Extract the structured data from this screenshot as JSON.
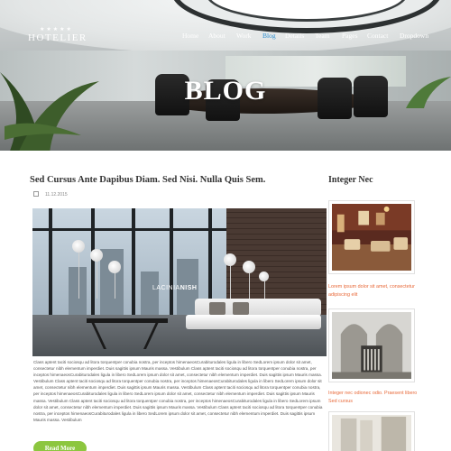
{
  "header": {
    "logo_stars": "★★★★★",
    "logo_text": "HOTELIER",
    "nav": [
      {
        "label": "Home",
        "active": false
      },
      {
        "label": "About",
        "active": false
      },
      {
        "label": "Work",
        "active": false
      },
      {
        "label": "Blog",
        "active": true
      },
      {
        "label": "Details",
        "active": false
      },
      {
        "label": "Team",
        "active": false
      },
      {
        "label": "Pages",
        "active": false
      },
      {
        "label": "Contact",
        "active": false
      },
      {
        "label": "Dropdown",
        "active": false
      }
    ],
    "hero_title": "BLOG"
  },
  "post": {
    "title": "Sed Cursus Ante Dapibus Diam. Sed Nisi. Nulla Quis Sem.",
    "date": "11.12.2015",
    "image_caption_light": "LACINIA",
    "image_caption_bold": "NISH",
    "body": "Class aptent taciti sociosqu ad litora torquentper conubia nostra, per inceptos himenaeosCurabiturodales ligula in libero SedLorem ipsum dolor sit amet, consectetur nibh elementum imperdiet. Duis sagittis ipsum Mauris massa. Vestibulum Class aptent taciti sociosqu ad litora torquentper conubia nostra, per inceptos himenaeosCurabiturodales ligula in libero SedLorem ipsum dolor sit amet, consectetur nibh elementum imperdiet. Duis sagittis ipsum Mauris massa. Vestibulum Class aptent taciti sociosqu ad litora torquentper conubia nostra, per inceptos himenaeosCurabiturodales ligula in libero SedLorem ipsum dolor sit amet, consectetur nibh elementum imperdiet. Duis sagittis ipsum Mauris massa. Vestibulum Class aptent taciti sociosqu ad litora torquentper conubia nostra, per inceptos himenaeosCurabiturodales ligula in libero SedLorem ipsum dolor sit amet, consectetur nibh elementum imperdiet. Duis sagittis ipsum Mauris massa. Vestibulum Class aptent taciti sociosqu ad litora torquentper conubia nostra, per inceptos himenaeosCurabiturodales ligula in libero SedLorem ipsum dolor sit amet, consectetur nibh elementum imperdiet. Duis sagittis ipsum Mauris massa. Vestibulum Class aptent taciti sociosqu ad litora torquentper conubia nostra, per inceptos himenaeosCurabiturodales ligula in libero SedLorem ipsum dolor sit amet, consectetur nibh elementum imperdiet. Duis sagittis ipsum Mauris massa. Vestibulum",
    "read_more": "Read More"
  },
  "sidebar": {
    "title": "Integer Nec",
    "items": [
      {
        "text": "Lorem ipsum dolor sit amet, consectetur adipiscing elit"
      },
      {
        "text": "Integer nec odionec odio. Praesent libero Sed cursus"
      }
    ]
  },
  "colors": {
    "accent_blue": "#2f8fcf",
    "read_more_green": "#8cc63f",
    "sidebar_link_orange": "#e86a3a"
  }
}
